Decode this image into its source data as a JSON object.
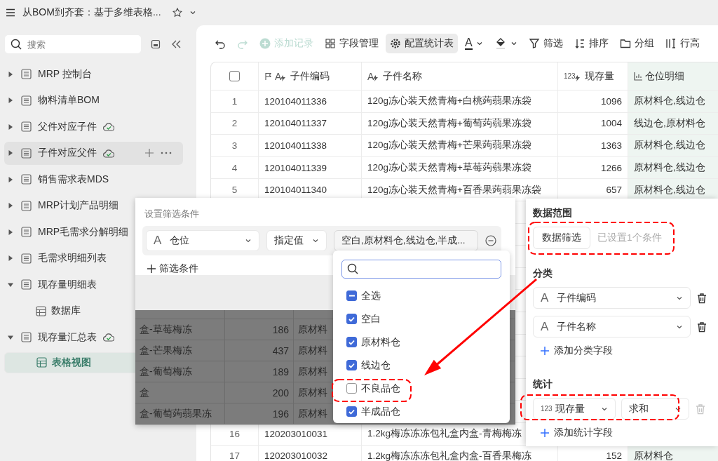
{
  "header": {
    "title": "从BOM到齐套：基于多维表格..."
  },
  "sidebar": {
    "search": {
      "placeholder": "搜索"
    },
    "items": [
      {
        "label": "MRP 控制台",
        "expanded": false,
        "synced": false,
        "hovered": false,
        "selected": false
      },
      {
        "label": "物料清单BOM",
        "expanded": false,
        "synced": false,
        "hovered": false,
        "selected": false
      },
      {
        "label": "父件对应子件",
        "expanded": false,
        "synced": true,
        "hovered": false,
        "selected": false
      },
      {
        "label": "子件对应父件",
        "expanded": false,
        "synced": true,
        "hovered": true,
        "selected": false
      },
      {
        "label": "销售需求表MDS",
        "expanded": false,
        "synced": false,
        "hovered": false,
        "selected": false
      },
      {
        "label": "MRP计划产品明细",
        "expanded": false,
        "synced": false,
        "hovered": false,
        "selected": false
      },
      {
        "label": "MRP毛需求分解明细",
        "expanded": false,
        "synced": false,
        "hovered": false,
        "selected": false
      },
      {
        "label": "毛需求明细列表",
        "expanded": false,
        "synced": false,
        "hovered": false,
        "selected": false
      },
      {
        "label": "现存量明细表",
        "expanded": true,
        "synced": false,
        "hovered": false,
        "selected": false,
        "children": [
          {
            "label": "数据库",
            "selected": false
          }
        ]
      },
      {
        "label": "现存量汇总表",
        "expanded": true,
        "synced": true,
        "hovered": false,
        "selected": false,
        "children": [
          {
            "label": "表格视图",
            "selected": true
          }
        ]
      }
    ]
  },
  "toolbar": [
    {
      "kind": "undo",
      "disabled": false,
      "active": false
    },
    {
      "kind": "redo",
      "disabled": true,
      "active": false
    },
    {
      "kind": "add",
      "label": "添加记录",
      "disabled": true,
      "active": false
    },
    {
      "kind": "fields",
      "label": "字段管理",
      "disabled": false,
      "active": false
    },
    {
      "kind": "config",
      "label": "配置统计表",
      "disabled": false,
      "active": true
    },
    {
      "kind": "text-color",
      "glyph": "A",
      "disabled": false,
      "active": false
    },
    {
      "kind": "fill-color",
      "disabled": false,
      "active": false
    },
    {
      "kind": "filter",
      "label": "筛选",
      "disabled": false,
      "active": false
    },
    {
      "kind": "sort",
      "label": "排序",
      "disabled": false,
      "active": false
    },
    {
      "kind": "group",
      "label": "分组",
      "disabled": false,
      "active": false
    },
    {
      "kind": "row-height",
      "label": "行高",
      "disabled": false,
      "active": false
    }
  ],
  "table": {
    "all_checked": false,
    "columns": [
      {
        "kind": "primary",
        "type_glyph": "A",
        "label": "子件编码",
        "highlighted": false
      },
      {
        "kind": "text",
        "type_glyph": "A",
        "label": "子件名称",
        "highlighted": false
      },
      {
        "kind": "number",
        "type_glyph": "123",
        "label": "现存量",
        "highlighted": false
      },
      {
        "kind": "stats",
        "label": "仓位明细",
        "highlighted": true
      }
    ],
    "rows": [
      {
        "number": "1",
        "code": "120104011336",
        "name": "120g冻心装天然青梅+白桃蒟蒻果冻袋",
        "qty": "1096",
        "location": "原材料仓,线边仓"
      },
      {
        "number": "2",
        "code": "120104011337",
        "name": "120g冻心装天然青梅+葡萄蒟蒻果冻袋",
        "qty": "1004",
        "location": "线边仓,原材料仓"
      },
      {
        "number": "3",
        "code": "120104011338",
        "name": "120g冻心装天然青梅+芒果蒟蒻果冻袋",
        "qty": "1363",
        "location": "原材料仓,线边仓"
      },
      {
        "number": "4",
        "code": "120104011339",
        "name": "120g冻心装天然青梅+草莓蒟蒻果冻袋",
        "qty": "1266",
        "location": "原材料仓,线边仓"
      },
      {
        "number": "5",
        "code": "120104011340",
        "name": "120g冻心装天然青梅+百香果蒟蒻果冻袋",
        "qty": "657",
        "location": "原材料仓,线边仓"
      }
    ],
    "bottom_rows": [
      {
        "number": "16",
        "code": "120203010031",
        "name": "1.2kg梅冻冻冻包礼盒内盒-青梅梅冻"
      },
      {
        "number": "17",
        "code": "120203010032",
        "name": "1.2kg梅冻冻冻包礼盒内盒-百香果梅冻",
        "qty": "152",
        "location": "原材料仓"
      }
    ]
  },
  "filter_popup": {
    "title": "设置筛选条件",
    "condition": {
      "type_glyph": "A",
      "field": "仓位",
      "operator": "指定值",
      "value": "空白,原材料仓,线边仓,半成...",
      "open": true
    },
    "add_label": "筛选条件",
    "background_rows": [
      {
        "name": "盒-草莓梅冻",
        "qty": "186",
        "location": "原材料"
      },
      {
        "name": "盒-芒果梅冻",
        "qty": "437",
        "location": "原材料"
      },
      {
        "name": "盒-葡萄梅冻",
        "qty": "189",
        "location": "原材料"
      },
      {
        "name": "盒",
        "qty": "200",
        "location": "原材料"
      },
      {
        "name": "盒-葡萄蒟蒻果冻",
        "qty": "196",
        "location": "原材料"
      }
    ]
  },
  "dropdown": {
    "select_all": {
      "label": "全选",
      "indeterminate": true
    },
    "options": [
      {
        "label": "空白",
        "checked": true
      },
      {
        "label": "原材料仓",
        "checked": true
      },
      {
        "label": "线边仓",
        "checked": true
      },
      {
        "label": "不良品仓",
        "checked": false
      },
      {
        "label": "半成品仓",
        "checked": true
      }
    ]
  },
  "stats_panel": {
    "range_title": "数据范围",
    "filter_button": "数据筛选",
    "filter_summary": "已设置1个条件",
    "category_title": "分类",
    "categories": [
      {
        "type_glyph": "A",
        "label": "子件编码"
      },
      {
        "type_glyph": "A",
        "label": "子件名称"
      }
    ],
    "add_category": "添加分类字段",
    "stats_title": "统计",
    "stats": [
      {
        "type_glyph": "123",
        "field": "现存量",
        "method": "求和",
        "removable": false
      }
    ],
    "add_stat": "添加统计字段"
  }
}
